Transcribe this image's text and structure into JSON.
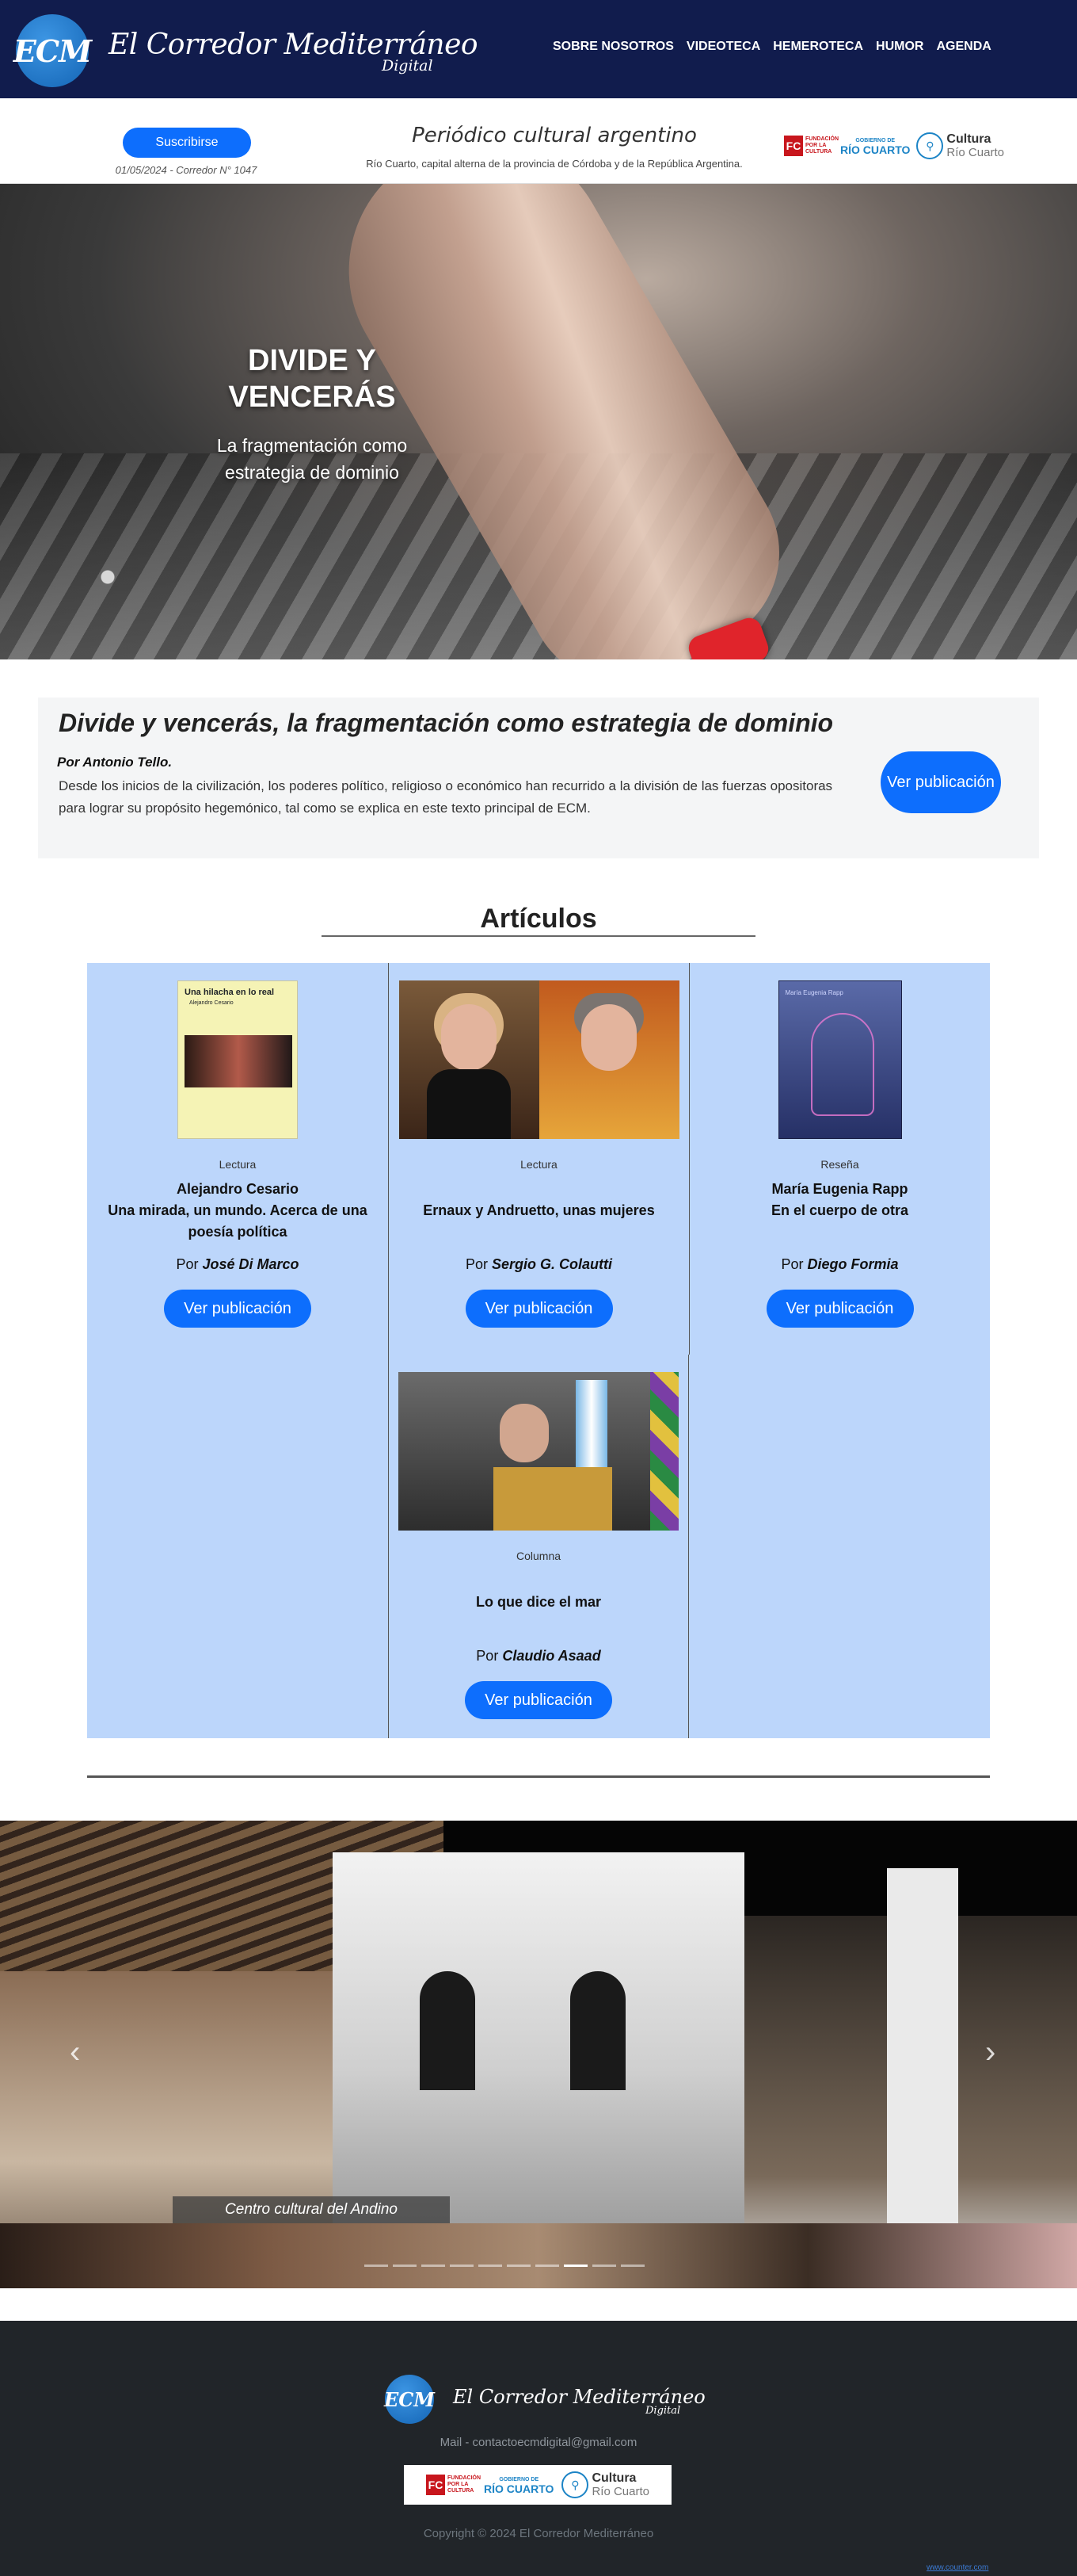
{
  "nav": {
    "logo_initials": "ECM",
    "logo_name": "El Corredor Mediterráneo",
    "logo_sub": "Digital",
    "links": [
      "SOBRE NOSOTROS",
      "VIDEOTECA",
      "HEMEROTECA",
      "HUMOR",
      "AGENDA"
    ]
  },
  "subheader": {
    "subscribe_label": "Suscribirse",
    "issue": "01/05/2024 - Corredor N° 1047",
    "tagline": "Periódico cultural argentino",
    "tagline_sub": "Río Cuarto, capital alterna de la provincia de Córdoba y de la República Argentina.",
    "sponsors": {
      "fc_mark": "FC",
      "fc_text": "FUNDACIÓN POR LA CULTURA",
      "rc_top": "GOBIERNO DE",
      "rc_main": "RÍO CUARTO",
      "cu_main": "Cultura",
      "cu_sub": "Río Cuarto"
    }
  },
  "hero": {
    "title": "DIVIDE Y VENCERÁS",
    "subtitle": "La fragmentación como estrategia de dominio"
  },
  "feature": {
    "title": "Divide y vencerás, la fragmentación como estrategia de dominio",
    "author": "Por Antonio Tello.",
    "excerpt": "Desde los inicios de la civilización, los poderes político, religioso o económico han recurrido a la división de las fuerzas opositoras para lograr su propósito hegemónico, tal como se explica en este texto principal de ECM.",
    "button_label": "Ver publicación"
  },
  "articles": {
    "section_title": "Artículos",
    "byline_prefix": "Por",
    "items": [
      {
        "category": "Lectura",
        "heading": "Alejandro Cesario\nUna mirada, un mundo. Acerca de una poesía política",
        "author": "José Di Marco",
        "button": "Ver publicación",
        "book_title": "Una hilacha en lo real",
        "book_author": "Alejandro Cesario"
      },
      {
        "category": "Lectura",
        "heading": "Ernaux y Andruetto, unas mujeres",
        "author": "Sergio G. Colautti",
        "button": "Ver publicación"
      },
      {
        "category": "Reseña",
        "heading": "María Eugenia Rapp\nEn el cuerpo de otra",
        "author": "Diego Formia",
        "button": "Ver publicación",
        "book_label": "María Eugenia Rapp"
      },
      {
        "category": "Columna",
        "heading": "Lo que dice el mar",
        "author": "Claudio Asaad",
        "button": "Ver publicación"
      }
    ]
  },
  "carousel": {
    "caption": "Centro cultural del Andino",
    "prev_icon": "‹",
    "next_icon": "›",
    "indicator_count": 10,
    "active_index": 7
  },
  "footer": {
    "logo_initials": "ECM",
    "logo_name": "El Corredor Mediterráneo",
    "logo_sub": "Digital",
    "mail": "Mail - contactoecmdigital@gmail.com",
    "copyright": "Copyright © 2024 El Corredor Mediterráneo",
    "badge": "www.counter.com"
  },
  "colors": {
    "navbar": "#111c4d",
    "primary_button": "#0d6efd",
    "articles_bg": "#bcd6fb",
    "footer_bg": "#212529"
  }
}
